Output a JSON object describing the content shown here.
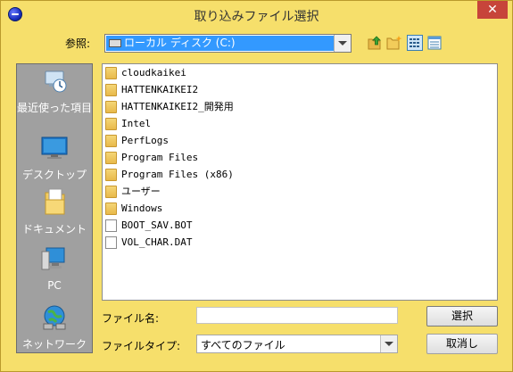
{
  "window": {
    "title": "取り込みファイル選択",
    "close_glyph": "✕"
  },
  "toolbar": {
    "lookin_label": "参照:",
    "lookin_value": "ローカル ディスク (C:)"
  },
  "places": [
    {
      "label": "最近使った項目",
      "icon": "recent-places-icon"
    },
    {
      "label": "デスクトップ",
      "icon": "desktop-icon"
    },
    {
      "label": "ドキュメント",
      "icon": "documents-icon"
    },
    {
      "label": "PC",
      "icon": "computer-icon"
    },
    {
      "label": "ネットワーク",
      "icon": "network-icon"
    }
  ],
  "files": [
    {
      "name": "cloudkaikei",
      "type": "folder"
    },
    {
      "name": "HATTENKAIKEI2",
      "type": "folder"
    },
    {
      "name": "HATTENKAIKEI2_開発用",
      "type": "folder"
    },
    {
      "name": "Intel",
      "type": "folder"
    },
    {
      "name": "PerfLogs",
      "type": "folder"
    },
    {
      "name": "Program Files",
      "type": "folder"
    },
    {
      "name": "Program Files (x86)",
      "type": "folder"
    },
    {
      "name": "ユーザー",
      "type": "folder"
    },
    {
      "name": "Windows",
      "type": "folder"
    },
    {
      "name": "BOOT_SAV.BOT",
      "type": "file"
    },
    {
      "name": "VOL_CHAR.DAT",
      "type": "file"
    }
  ],
  "form": {
    "filename_label": "ファイル名:",
    "filename_value": "",
    "filetype_label": "ファイルタイプ:",
    "filetype_value": "すべてのファイル"
  },
  "buttons": {
    "open": "選択",
    "cancel": "取消し"
  },
  "colors": {
    "window_frame": "#f6df6b",
    "selection": "#3399ff",
    "places_bg": "#a0a0a0",
    "close_button": "#c7443a"
  }
}
